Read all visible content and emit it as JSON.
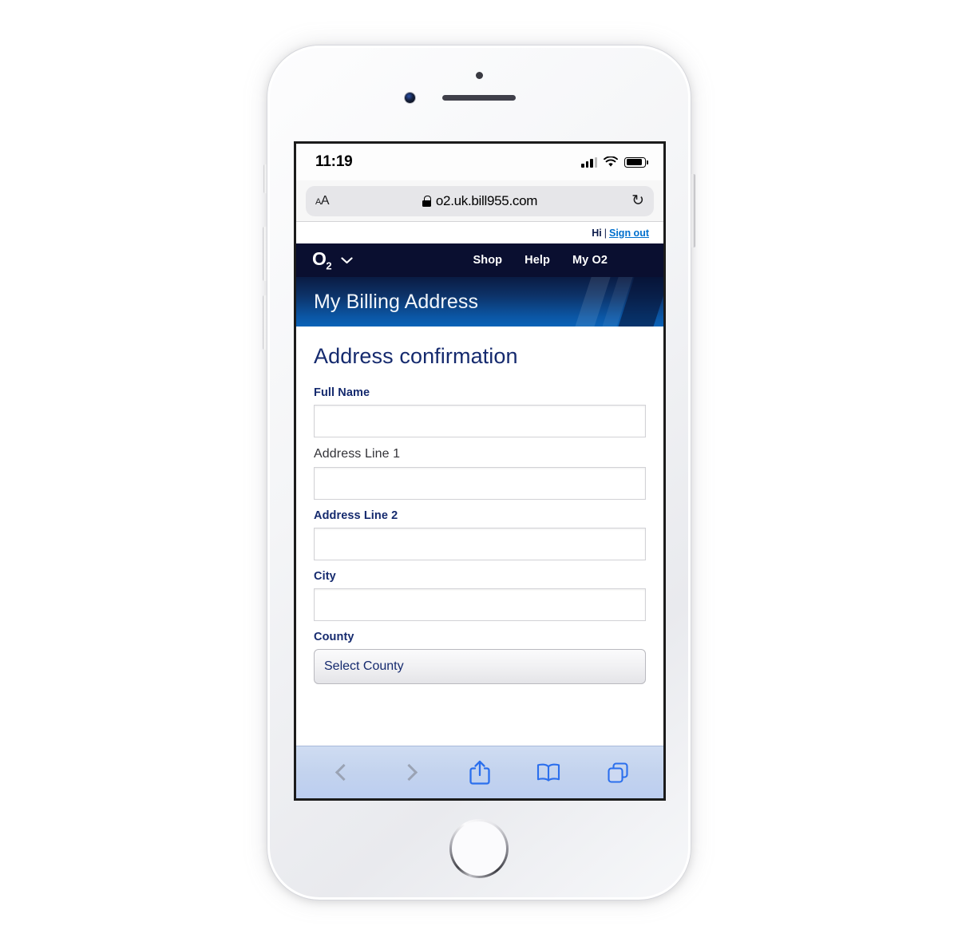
{
  "device": {
    "type": "iphone-white",
    "home_button": "home-button",
    "camera": "front-camera",
    "speaker": "speaker-grille"
  },
  "status_bar": {
    "time": "11:19",
    "signal_icon": "cellular-signal-icon",
    "wifi_icon": "wifi-icon",
    "battery_icon": "battery-icon",
    "signal_bars_filled": 3,
    "signal_bars_total": 4,
    "battery_level_pct": 90
  },
  "browser": {
    "name": "Safari",
    "text_size_button": "AA",
    "lock_icon": "lock-icon",
    "url": "o2.uk.bill955.com",
    "reload_icon": "↻",
    "toolbar": {
      "back_icon": "chevron-left-icon",
      "forward_icon": "chevron-right-icon",
      "share_icon": "share-icon",
      "bookmarks_icon": "book-icon",
      "tabs_icon": "tabs-icon",
      "back_enabled": false,
      "forward_enabled": false
    }
  },
  "utility_bar": {
    "greeting": "Hi",
    "separator": "|",
    "sign_out": "Sign out"
  },
  "site_nav": {
    "logo_letter": "O",
    "logo_sub": "2",
    "chevron_icon": "chevron-down-icon",
    "links": [
      {
        "label": "Shop"
      },
      {
        "label": "Help"
      },
      {
        "label": "My O2"
      }
    ]
  },
  "banner": {
    "title": "My Billing Address"
  },
  "form": {
    "heading": "Address confirmation",
    "fields": [
      {
        "label": "Full Name",
        "value": "",
        "placeholder": "",
        "style": "navy",
        "control": "text"
      },
      {
        "label": "Address Line 1",
        "value": "",
        "placeholder": "",
        "style": "plain",
        "control": "text"
      },
      {
        "label": "Address Line 2",
        "value": "",
        "placeholder": "",
        "style": "navy",
        "control": "text"
      },
      {
        "label": "City",
        "value": "",
        "placeholder": "",
        "style": "navy",
        "control": "text"
      },
      {
        "label": "County",
        "value": "Select County",
        "placeholder": "",
        "style": "navy",
        "control": "select"
      }
    ]
  },
  "colors": {
    "o2_navy": "#0a0f30",
    "banner_blue": "#0a63b8",
    "heading_navy": "#152a6e",
    "link_blue": "#0070cd",
    "safari_toolbar_blue": "#c3d3ee",
    "icon_blue": "#2b6fed"
  }
}
